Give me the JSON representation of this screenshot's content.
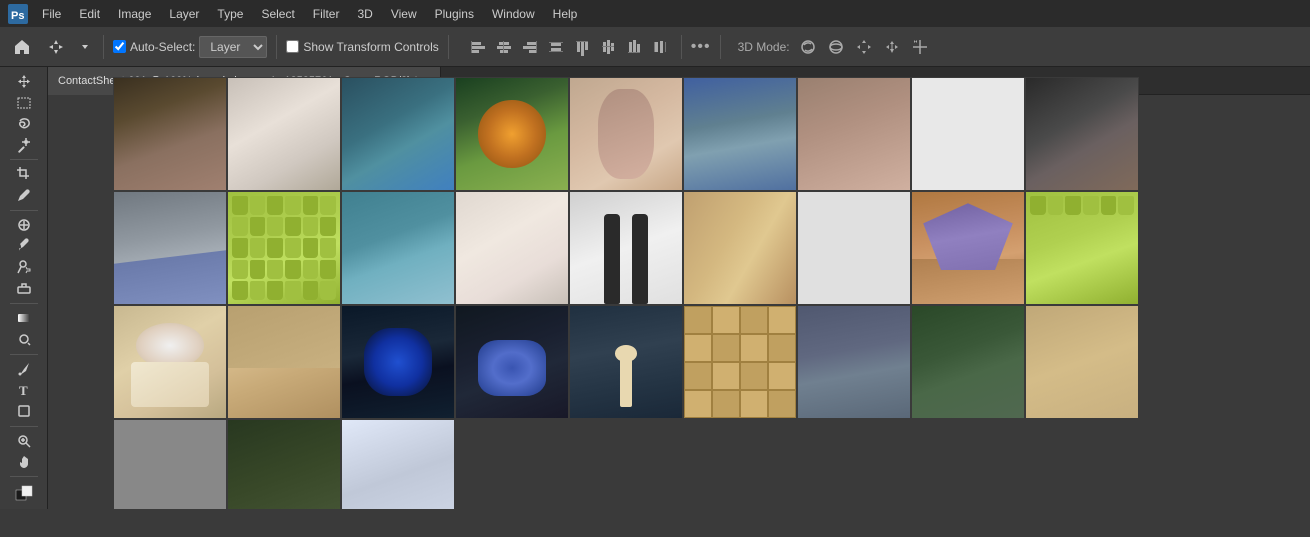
{
  "menubar": {
    "items": [
      "File",
      "Edit",
      "Image",
      "Layer",
      "Type",
      "Select",
      "Filter",
      "3D",
      "View",
      "Plugins",
      "Window",
      "Help"
    ]
  },
  "toolbar": {
    "auto_select_label": "Auto-Select:",
    "layer_value": "Layer",
    "show_transform_label": "Show Transform Controls",
    "more_label": "•••",
    "mode_label": "3D Mode:"
  },
  "tab": {
    "title": "ContactSheet-001 @ 100% (pexels-boom- ✳ -12585761 - Copy, RGB/8) *",
    "close": "×"
  },
  "tools": [
    "move",
    "marquee",
    "lasso",
    "magic",
    "crop",
    "eyedropper",
    "healing",
    "brush",
    "clone",
    "eraser",
    "gradient",
    "dodge",
    "pen",
    "text",
    "shape",
    "zoom"
  ],
  "photos": [
    {
      "id": "p1",
      "desc": "stairs"
    },
    {
      "id": "p2",
      "desc": "sky-object"
    },
    {
      "id": "p3",
      "desc": "palm-trees"
    },
    {
      "id": "p4",
      "desc": "papaya"
    },
    {
      "id": "p5",
      "desc": "portrait"
    },
    {
      "id": "p6",
      "desc": "river"
    },
    {
      "id": "p7",
      "desc": "architecture"
    },
    {
      "id": "p8",
      "desc": "empty"
    },
    {
      "id": "p10",
      "desc": "architecture2"
    },
    {
      "id": "p11",
      "desc": "stadium-seats"
    },
    {
      "id": "p12",
      "desc": "beach-aerial"
    },
    {
      "id": "p13",
      "desc": "cafe"
    },
    {
      "id": "p14",
      "desc": "women-standing"
    },
    {
      "id": "p15",
      "desc": "books"
    },
    {
      "id": "p16",
      "desc": "empty2"
    },
    {
      "id": "p17",
      "desc": "mountains"
    },
    {
      "id": "p19",
      "desc": "coffee"
    },
    {
      "id": "p20",
      "desc": "portrait2"
    },
    {
      "id": "p21",
      "desc": "blue-portrait"
    },
    {
      "id": "p22",
      "desc": "neon"
    },
    {
      "id": "p23",
      "desc": "forest-figure"
    },
    {
      "id": "p27",
      "desc": "tile"
    },
    {
      "id": "p28",
      "desc": "rock"
    },
    {
      "id": "p29",
      "desc": "canyon"
    }
  ]
}
